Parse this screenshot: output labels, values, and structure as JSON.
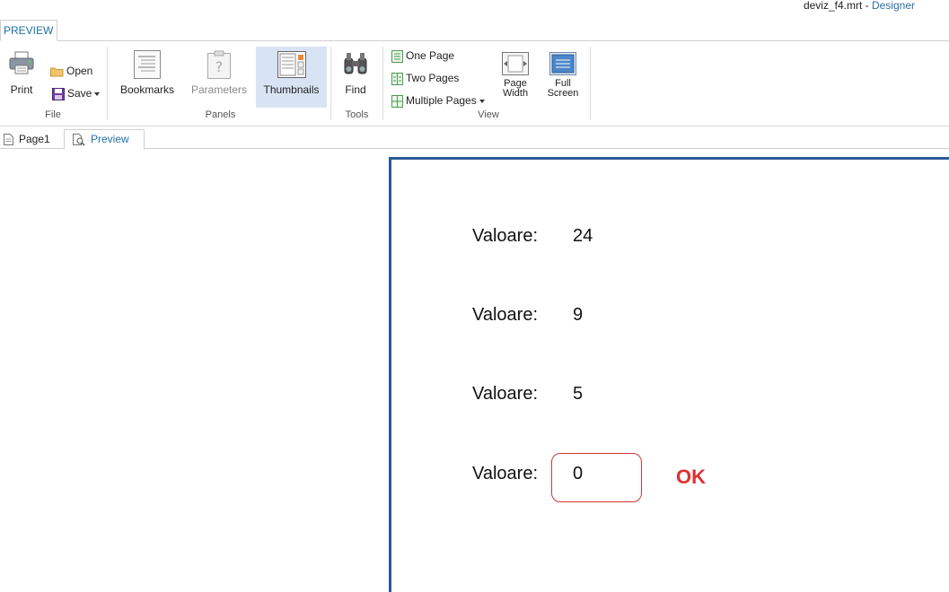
{
  "titlebar": {
    "filename": "deviz_f4.mrt",
    "separator": " - ",
    "designer_link": "Designer"
  },
  "ribbon": {
    "active_tab": "PREVIEW",
    "groups": {
      "file": {
        "label": "File",
        "print": "Print",
        "open": "Open",
        "save": "Save"
      },
      "panels": {
        "label": "Panels",
        "bookmarks": "Bookmarks",
        "parameters": "Parameters",
        "thumbnails": "Thumbnails"
      },
      "tools": {
        "label": "Tools",
        "find": "Find"
      },
      "view": {
        "label": "View",
        "one_page": "One Page",
        "two_pages": "Two Pages",
        "multiple_pages": "Multiple Pages",
        "page_width_line1": "Page",
        "page_width_line2": "Width",
        "full_screen_line1": "Full",
        "full_screen_line2": "Screen"
      }
    }
  },
  "doc_tabs": {
    "page1": "Page1",
    "preview": "Preview"
  },
  "report": {
    "rows": [
      {
        "label": "Valoare:",
        "value": "24"
      },
      {
        "label": "Valoare:",
        "value": "9"
      },
      {
        "label": "Valoare:",
        "value": "5"
      },
      {
        "label": "Valoare:",
        "value": "0"
      }
    ],
    "status": "OK"
  },
  "colors": {
    "accent": "#1e6fa8",
    "page_border": "#2b5a96",
    "ok": "#e03030",
    "active_button": "#d8e4f3"
  }
}
